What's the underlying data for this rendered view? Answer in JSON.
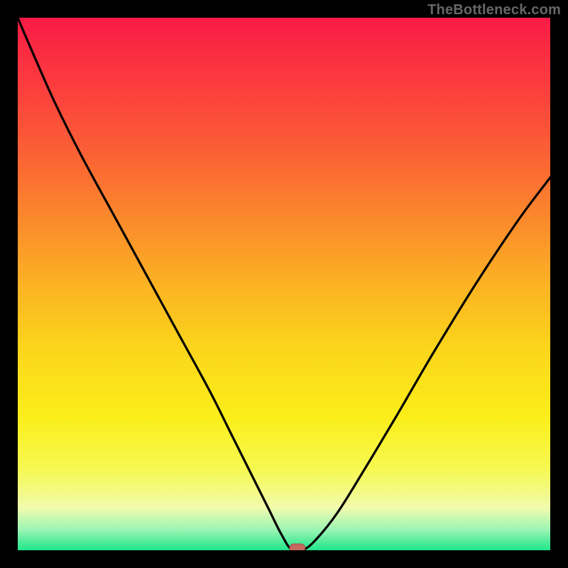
{
  "watermark": "TheBottleneck.com",
  "colors": {
    "frame": "#000000",
    "gradient_top": "#fa1b46",
    "gradient_mid": "#fbd51b",
    "gradient_bottom": "#1fe68a",
    "curve": "#000000",
    "marker": "#c46a61"
  },
  "chart_data": {
    "type": "line",
    "title": "",
    "xlabel": "",
    "ylabel": "",
    "xlim": [
      0,
      100
    ],
    "ylim": [
      0,
      100
    ],
    "x": [
      0,
      3,
      7,
      12,
      18,
      24,
      30,
      36,
      40,
      44,
      47,
      49.5,
      51.5,
      53.5,
      56,
      60,
      65,
      71,
      78,
      86,
      94,
      100
    ],
    "y": [
      100,
      93,
      84,
      74,
      63,
      52,
      41,
      30,
      22,
      14,
      8,
      3,
      0,
      0,
      2,
      7,
      15,
      25,
      37,
      50,
      62,
      70
    ],
    "marker": {
      "x": 52.5,
      "y": 0
    },
    "note": "x and y are percentages of the plot extent; y=100 is top, y=0 is bottom (optimal/green). Values estimated from pixels."
  }
}
